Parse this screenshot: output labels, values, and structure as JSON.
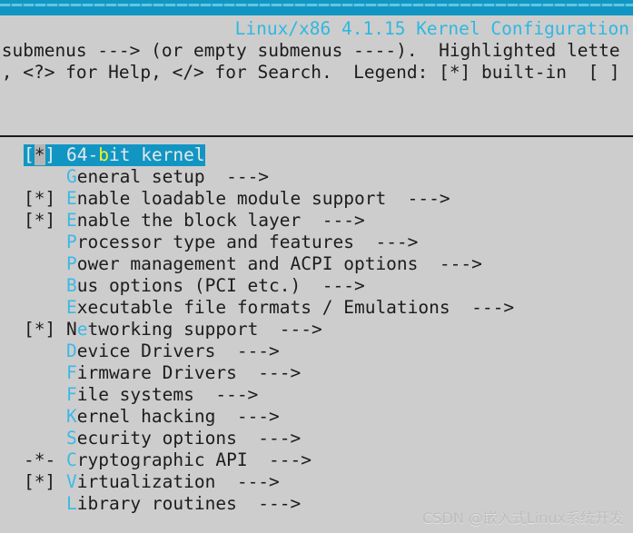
{
  "window": {
    "background_color": "#cdcdcd",
    "accent_color": "#1196c4",
    "hotkey_color": "#3cb9e5",
    "selected_hotkey_color": "#f2f221",
    "text_color": "#1c1c1c"
  },
  "header": {
    "title": "Linux/x86 4.1.15 Kernel Configuration",
    "help_line_1": " submenus ---> (or empty submenus ----).  Highlighted lette",
    "help_line_2": "t, <?> for Help, </> for Search.  Legend: [*] built-in  [ ]"
  },
  "menu": {
    "selected_index": 0,
    "items": [
      {
        "mark": "[*]",
        "prefix": "",
        "hotkey": "6",
        "hotkey_index": 3,
        "pre": "64-",
        "hot": "b",
        "post": "it kernel",
        "arrow": "",
        "selected": true
      },
      {
        "mark": "   ",
        "pre": "",
        "hot": "G",
        "post": "eneral setup",
        "arrow": "  --->",
        "selected": false
      },
      {
        "mark": "[*]",
        "pre": "",
        "hot": "E",
        "post": "nable loadable module support",
        "arrow": "  --->",
        "selected": false
      },
      {
        "mark": "[*]",
        "pre": "",
        "hot": "E",
        "post": "nable the block layer",
        "arrow": "  --->",
        "selected": false
      },
      {
        "mark": "   ",
        "pre": "",
        "hot": "P",
        "post": "rocessor type and features",
        "arrow": "  --->",
        "selected": false
      },
      {
        "mark": "   ",
        "pre": "",
        "hot": "P",
        "post": "ower management and ACPI options",
        "arrow": "  --->",
        "selected": false
      },
      {
        "mark": "   ",
        "pre": "",
        "hot": "B",
        "post": "us options (PCI etc.)",
        "arrow": "  --->",
        "selected": false
      },
      {
        "mark": "   ",
        "pre": "",
        "hot": "E",
        "post": "xecutable file formats / Emulations",
        "arrow": "  --->",
        "selected": false
      },
      {
        "mark": "[*]",
        "pre": "N",
        "hot": "e",
        "post": "tworking support",
        "arrow": "  --->",
        "selected": false
      },
      {
        "mark": "   ",
        "pre": "",
        "hot": "D",
        "post": "evice Drivers",
        "arrow": "  --->",
        "selected": false
      },
      {
        "mark": "   ",
        "pre": "",
        "hot": "F",
        "post": "irmware Drivers",
        "arrow": "  --->",
        "selected": false
      },
      {
        "mark": "   ",
        "pre": "",
        "hot": "F",
        "post": "ile systems",
        "arrow": "  --->",
        "selected": false
      },
      {
        "mark": "   ",
        "pre": "",
        "hot": "K",
        "post": "ernel hacking",
        "arrow": "  --->",
        "selected": false
      },
      {
        "mark": "   ",
        "pre": "",
        "hot": "S",
        "post": "ecurity options",
        "arrow": "  --->",
        "selected": false
      },
      {
        "mark": "-*-",
        "pre": "",
        "hot": "C",
        "post": "ryptographic API",
        "arrow": "  --->",
        "selected": false
      },
      {
        "mark": "[*]",
        "pre": "",
        "hot": "V",
        "post": "irtualization",
        "arrow": "  --->",
        "selected": false
      },
      {
        "mark": "   ",
        "pre": "",
        "hot": "L",
        "post": "ibrary routines",
        "arrow": "  --->",
        "selected": false
      }
    ]
  },
  "watermark": {
    "text": "CSDN @嵌入式Linux系统开发"
  }
}
